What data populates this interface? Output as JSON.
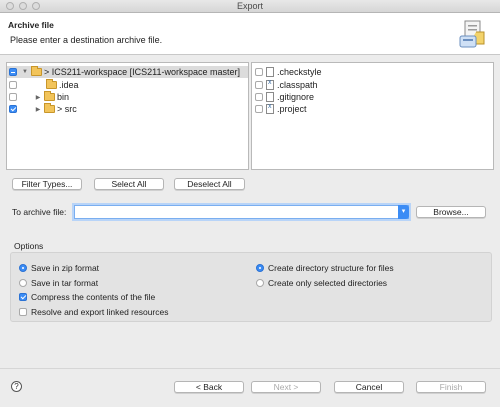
{
  "window": {
    "title": "Export"
  },
  "header": {
    "title": "Archive file",
    "message": "Please enter a destination archive file.",
    "icon": "export-archive-icon"
  },
  "left_tree": [
    {
      "label": "> ICS211-workspace [ICS211-workspace master]",
      "state": "mixed",
      "expanded": true
    },
    {
      "label": ".idea",
      "state": "unchecked"
    },
    {
      "label": "bin",
      "state": "unchecked"
    },
    {
      "label": "> src",
      "state": "checked"
    }
  ],
  "right_list": [
    {
      "label": ".checkstyle",
      "state": "unchecked"
    },
    {
      "label": ".classpath",
      "state": "unchecked"
    },
    {
      "label": ".gitignore",
      "state": "unchecked"
    },
    {
      "label": ".project",
      "state": "unchecked"
    }
  ],
  "selection_buttons": {
    "filter": "Filter Types...",
    "select_all": "Select All",
    "deselect_all": "Deselect All"
  },
  "archive": {
    "label": "To archive file:",
    "value": "",
    "browse": "Browse..."
  },
  "options": {
    "title": "Options",
    "zip": "Save in zip format",
    "tar": "Save in tar format",
    "compress": "Compress the contents of the file",
    "resolve": "Resolve and export linked resources",
    "dir_structure": "Create directory structure for files",
    "selected_dirs": "Create only selected directories"
  },
  "footer": {
    "help": "?",
    "back": "< Back",
    "next": "Next >",
    "cancel": "Cancel",
    "finish": "Finish"
  },
  "colors": {
    "accent": "#3b8cf5",
    "folder": "#f2c45a"
  }
}
